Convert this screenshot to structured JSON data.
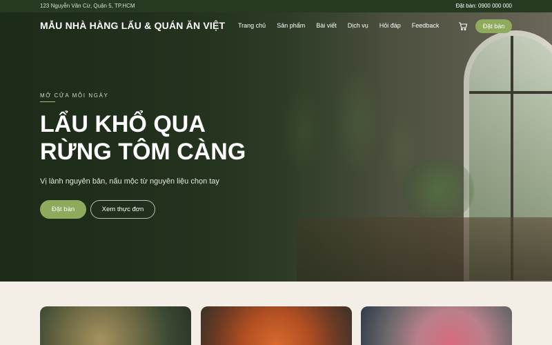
{
  "topbar": {
    "address": "123 Nguyễn Văn Cừ, Quận 5, TP.HCM",
    "phone": "Đặt bàn: 0900 000 000"
  },
  "header": {
    "logo": "MẪU NHÀ HÀNG LẨU & QUÁN ĂN VIỆT",
    "menu": [
      "Trang chủ",
      "Sản phẩm",
      "Bài viết",
      "Dịch vụ",
      "Hỏi đáp",
      "Feedback"
    ],
    "cart_icon": "cart-icon",
    "booking_button": "Đặt bàn"
  },
  "hero": {
    "eyebrow": "MỞ CỬA MỖI NGÀY",
    "title_line1": "LẨU KHỔ QUA",
    "title_line2": "RỪNG TÔM CÀNG",
    "subtitle": "Vị lành nguyên bản, nấu mộc từ nguyên liệu chọn tay",
    "primary_button": "Đặt bàn",
    "secondary_button": "Xem thực đơn"
  },
  "colors": {
    "accent": "#8faa5c",
    "dark_green": "#263a21",
    "section_bg": "#f4efe6"
  }
}
